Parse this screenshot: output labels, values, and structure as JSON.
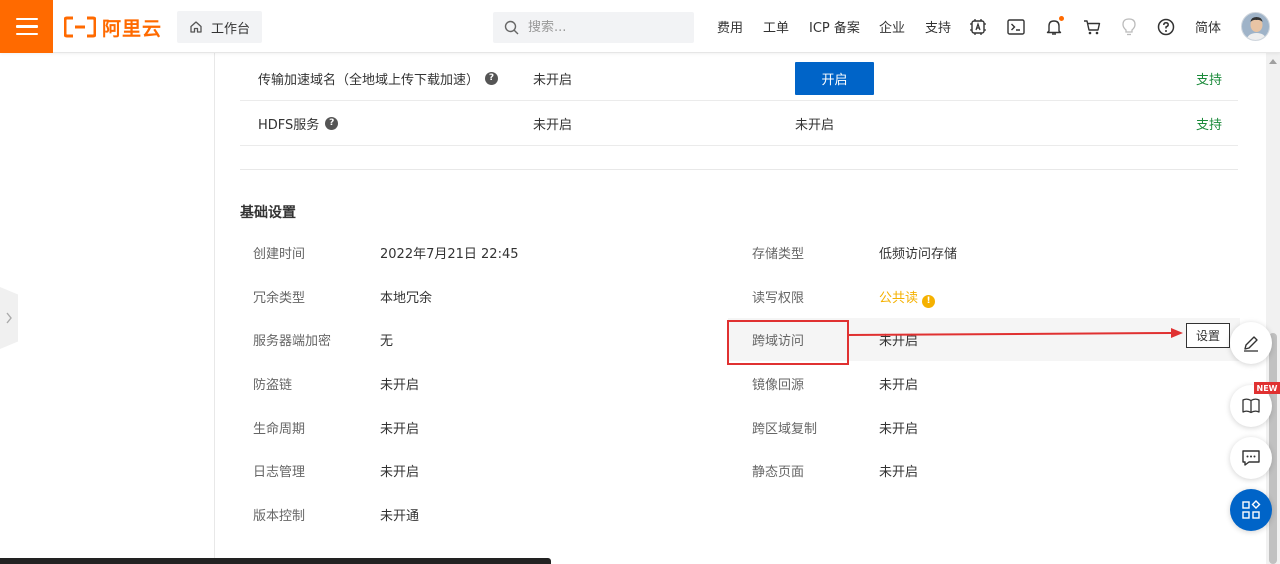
{
  "header": {
    "logo_text": "阿里云",
    "workbench_label": "工作台",
    "search_placeholder": "搜索...",
    "nav_links": {
      "fees": "费用",
      "tickets": "工单",
      "icp": "ICP 备案",
      "enterprise": "企业",
      "support": "支持",
      "language": "简体"
    },
    "icons": [
      "menu-icon",
      "home-icon",
      "search-icon",
      "app-icon",
      "terminal-icon",
      "bell-icon",
      "cart-icon",
      "lightbulb-icon",
      "help-icon"
    ]
  },
  "features": [
    {
      "name": "传输加速域名（全地域上传下载加速）",
      "status": "未开启",
      "action": "开启",
      "support": "支持"
    },
    {
      "name": "HDFS服务",
      "status": "未开启",
      "action": "未开启",
      "support": "支持"
    }
  ],
  "basic_settings": {
    "title": "基础设置",
    "left": [
      {
        "key": "创建时间",
        "value": "2022年7月21日 22:45"
      },
      {
        "key": "冗余类型",
        "value": "本地冗余"
      },
      {
        "key": "服务器端加密",
        "value": "无"
      },
      {
        "key": "防盗链",
        "value": "未开启"
      },
      {
        "key": "生命周期",
        "value": "未开启"
      },
      {
        "key": "日志管理",
        "value": "未开启"
      },
      {
        "key": "版本控制",
        "value": "未开通"
      }
    ],
    "right": [
      {
        "key": "存储类型",
        "value": "低频访问存储"
      },
      {
        "key": "读写权限",
        "value": "公共读"
      },
      {
        "key": "跨域访问",
        "value": "未开启"
      },
      {
        "key": "镜像回源",
        "value": "未开启"
      },
      {
        "key": "跨区域复制",
        "value": "未开启"
      },
      {
        "key": "静态页面",
        "value": "未开启"
      }
    ],
    "set_button": "设置"
  },
  "floating": {
    "new_badge": "NEW"
  },
  "colors": {
    "brand": "#ff6a00",
    "primary": "#0064c8",
    "support_green": "#1a8a3a",
    "warning": "#f5b100",
    "annotation_red": "#e03131"
  }
}
